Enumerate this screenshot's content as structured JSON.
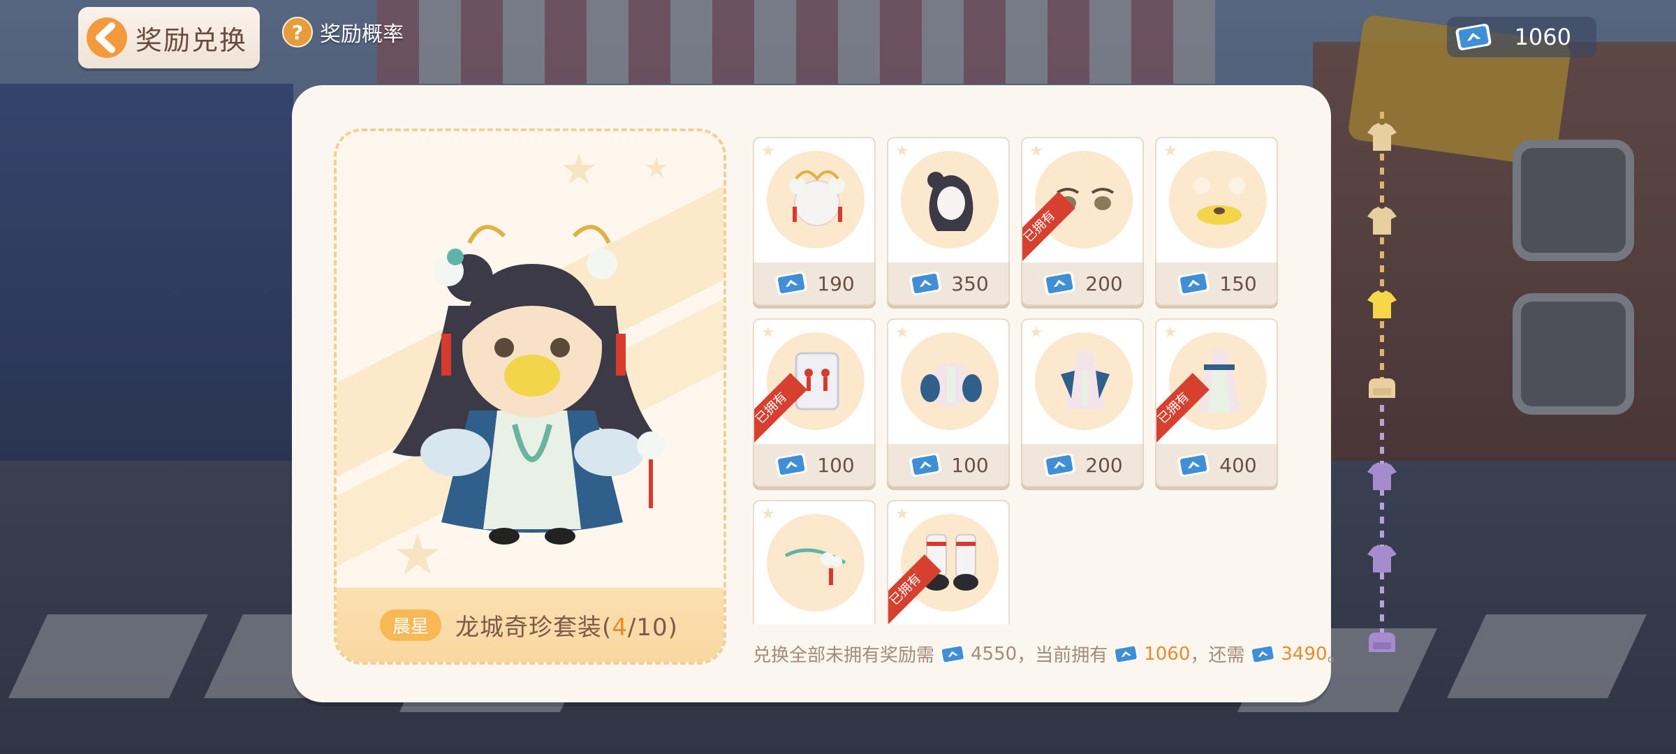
{
  "header": {
    "title": "奖励兑换",
    "help_label": "奖励概率",
    "currency_amount": "1060"
  },
  "showcase": {
    "rank_badge": "晨星",
    "set_name": "龙城奇珍套装(",
    "owned": "4",
    "separator": "/",
    "total": "10",
    "close": ")"
  },
  "items": [
    {
      "name": "hair-ornament",
      "price": "190",
      "owned": false,
      "owned_label": ""
    },
    {
      "name": "hairstyle",
      "price": "350",
      "owned": false,
      "owned_label": ""
    },
    {
      "name": "eyes",
      "price": "200",
      "owned": true,
      "owned_label": "已拥有"
    },
    {
      "name": "face-bear",
      "price": "150",
      "owned": false,
      "owned_label": ""
    },
    {
      "name": "earrings",
      "price": "100",
      "owned": true,
      "owned_label": "已拥有"
    },
    {
      "name": "top",
      "price": "100",
      "owned": false,
      "owned_label": ""
    },
    {
      "name": "outfit",
      "price": "200",
      "owned": false,
      "owned_label": ""
    },
    {
      "name": "dress",
      "price": "400",
      "owned": true,
      "owned_label": "已拥有"
    },
    {
      "name": "hand-accessory",
      "price": "",
      "owned": false,
      "owned_label": ""
    },
    {
      "name": "boots",
      "price": "",
      "owned": true,
      "owned_label": "已拥有"
    }
  ],
  "summary": {
    "prefix": "兑换全部未拥有奖励需",
    "need": "4550",
    "mid": "，当前拥有",
    "have": "1060",
    "mid2": "，还需",
    "remain": "3490",
    "suffix": "。"
  },
  "colors": {
    "accent": "#e98a2c",
    "panel": "#fbf6ee",
    "owned_ribbon": "#d6402f",
    "ticket": "#3f8ed6"
  }
}
